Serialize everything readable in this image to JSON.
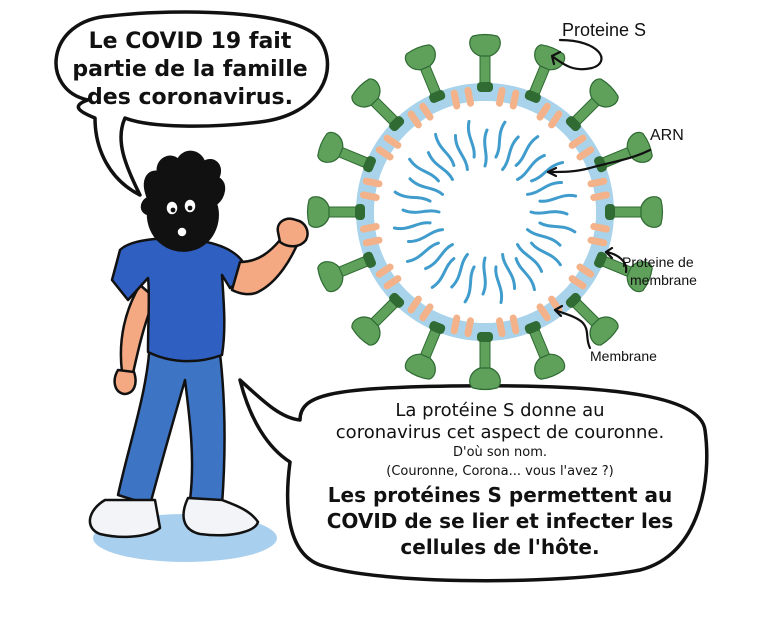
{
  "colors": {
    "shirt": "#2f5fc0",
    "jeans": "#3d74c4",
    "skin": "#f4a983",
    "spike": "#5fa05b",
    "spike_dark": "#2f6b33",
    "membrane_protein": "#f4b28a",
    "membrane": "#a9d3ea",
    "rna": "#3f9ccc",
    "shadow": "#a9cfee"
  },
  "speech_top": {
    "lines": [
      "Le COVID 19 fait",
      "partie de la famille",
      "des coronavirus."
    ]
  },
  "speech_bottom": {
    "line1": "La protéine S donne au",
    "line2": "coronavirus cet aspect de couronne.",
    "line3": "D'où son nom.",
    "line4": "(Couronne, Corona... vous l'avez ?)",
    "line5": "Les protéines S permettent au",
    "line6": "COVID de se lier et infecter les",
    "line7": "cellules de l'hôte."
  },
  "virus_labels": {
    "spike": "Proteine S",
    "rna": "ARN",
    "membrane_protein_1": "Proteine de",
    "membrane_protein_2": "membrane",
    "membrane": "Membrane"
  },
  "icons": {
    "character": "cartoon-person-icon",
    "virus": "coronavirus-icon"
  }
}
